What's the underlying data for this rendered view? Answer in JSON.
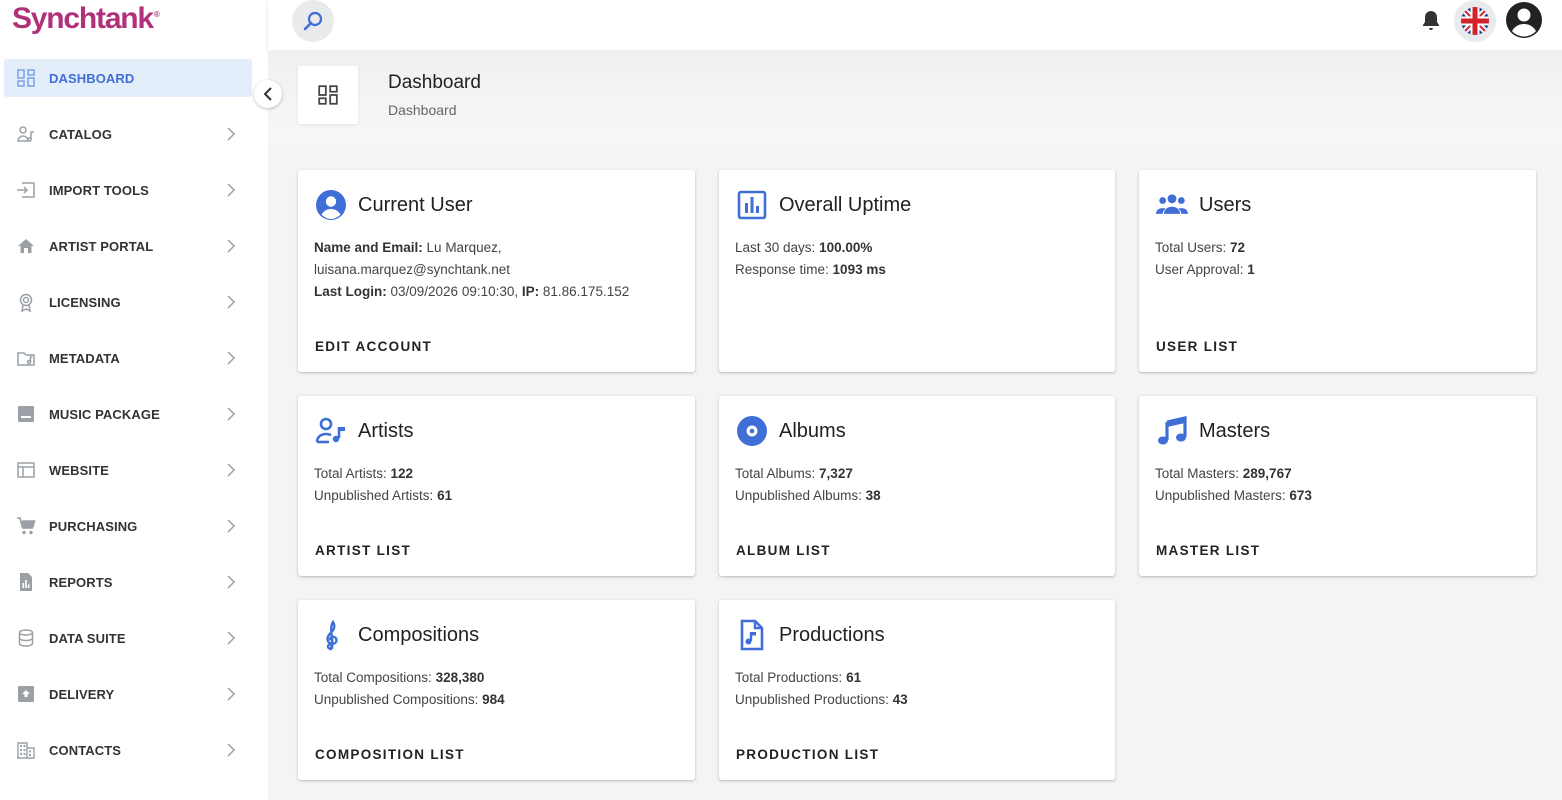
{
  "brand": {
    "name": "Synchtank",
    "mark": "®"
  },
  "sidebar": {
    "items": [
      {
        "label": "DASHBOARD"
      },
      {
        "label": "CATALOG"
      },
      {
        "label": "IMPORT TOOLS"
      },
      {
        "label": "ARTIST PORTAL"
      },
      {
        "label": "LICENSING"
      },
      {
        "label": "METADATA"
      },
      {
        "label": "MUSIC PACKAGE"
      },
      {
        "label": "WEBSITE"
      },
      {
        "label": "PURCHASING"
      },
      {
        "label": "REPORTS"
      },
      {
        "label": "DATA SUITE"
      },
      {
        "label": "DELIVERY"
      },
      {
        "label": "CONTACTS"
      }
    ]
  },
  "header": {
    "title": "Dashboard",
    "breadcrumb": "Dashboard"
  },
  "colors": {
    "accent": "#3f6fd6",
    "brand": "#b0307a",
    "active_bg": "#e3eefa"
  },
  "cards": {
    "current_user": {
      "title": "Current User",
      "name_label": "Name and Email:",
      "name_value": " Lu Marquez,",
      "email": "luisana.marquez@synchtank.net",
      "login_label": "Last Login:",
      "login_value": " 03/09/2026 09:10:30, ",
      "ip_label": "IP:",
      "ip_value": " 81.86.175.152",
      "action": "EDIT ACCOUNT"
    },
    "uptime": {
      "title": "Overall Uptime",
      "l1_label": "Last 30 days: ",
      "l1_value": "100.00%",
      "l2_label": "Response time: ",
      "l2_value": "1093 ms"
    },
    "users": {
      "title": "Users",
      "l1_label": "Total Users: ",
      "l1_value": "72",
      "l2_label": "User Approval: ",
      "l2_value": "1",
      "action": "USER LIST"
    },
    "artists": {
      "title": "Artists",
      "l1_label": "Total Artists: ",
      "l1_value": "122",
      "l2_label": "Unpublished Artists: ",
      "l2_value": "61",
      "action": "ARTIST LIST"
    },
    "albums": {
      "title": "Albums",
      "l1_label": "Total Albums: ",
      "l1_value": "7,327",
      "l2_label": "Unpublished Albums: ",
      "l2_value": "38",
      "action": "ALBUM LIST"
    },
    "masters": {
      "title": "Masters",
      "l1_label": "Total Masters: ",
      "l1_value": "289,767",
      "l2_label": "Unpublished Masters: ",
      "l2_value": "673",
      "action": "MASTER LIST"
    },
    "compositions": {
      "title": "Compositions",
      "l1_label": "Total Compositions: ",
      "l1_value": "328,380",
      "l2_label": "Unpublished Compositions: ",
      "l2_value": "984",
      "action": "COMPOSITION LIST"
    },
    "productions": {
      "title": "Productions",
      "l1_label": "Total Productions: ",
      "l1_value": "61",
      "l2_label": "Unpublished Productions: ",
      "l2_value": "43",
      "action": "PRODUCTION LIST"
    }
  }
}
